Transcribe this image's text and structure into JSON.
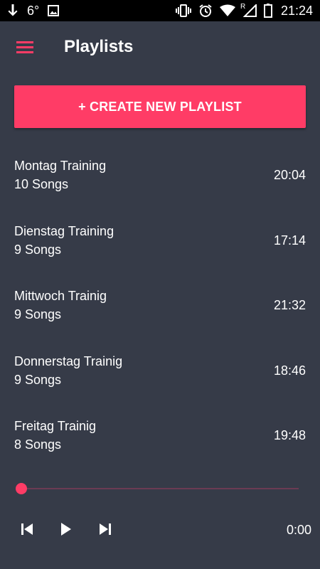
{
  "status_bar": {
    "temperature": "6°",
    "time": "21:24",
    "left_icons": [
      "download-arrow-icon",
      "image-icon"
    ],
    "right_icons": [
      "vibrate-icon",
      "alarm-icon",
      "wifi-icon",
      "signal-icon",
      "battery-icon"
    ],
    "signal_roaming": "R"
  },
  "app_bar": {
    "title": "Playlists",
    "menu_icon": "hamburger-menu-icon"
  },
  "create_button": {
    "label": "+ CREATE NEW PLAYLIST"
  },
  "playlists": [
    {
      "name": "Montag Training",
      "count": "10 Songs",
      "duration": "20:04"
    },
    {
      "name": "Dienstag Training",
      "count": "9 Songs",
      "duration": "17:14"
    },
    {
      "name": "Mittwoch Trainig",
      "count": "9 Songs",
      "duration": "21:32"
    },
    {
      "name": "Donnerstag Trainig",
      "count": "9 Songs",
      "duration": "18:46"
    },
    {
      "name": "Freitag Trainig",
      "count": "8 Songs",
      "duration": "19:48"
    }
  ],
  "player": {
    "progress": 0,
    "time": "0:00",
    "icons": [
      "skip-previous-icon",
      "play-icon",
      "skip-next-icon"
    ]
  },
  "colors": {
    "background": "#363b48",
    "accent": "#ff3c66",
    "status_bar": "#000000",
    "seek_track": "#6b3b53",
    "text": "#ffffff"
  }
}
